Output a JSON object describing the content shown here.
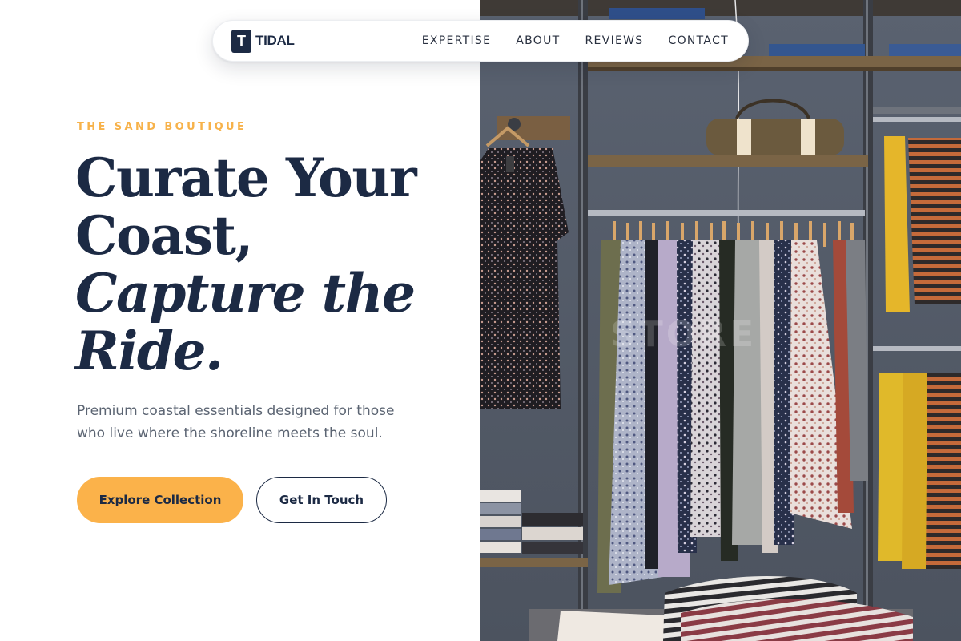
{
  "brand": {
    "logo_letter": "T",
    "name": "TIDAL"
  },
  "nav": {
    "links": [
      {
        "label": "EXPERTISE"
      },
      {
        "label": "ABOUT"
      },
      {
        "label": "REVIEWS"
      },
      {
        "label": "CONTACT"
      }
    ]
  },
  "hero": {
    "eyebrow": "THE SAND BOUTIQUE",
    "headline_line1": "Curate Your",
    "headline_line2": "Coast,",
    "headline_line3": "Capture the",
    "headline_line4": "Ride.",
    "description": "Premium coastal essentials designed for those who live where the shoreline meets the soul.",
    "primary_button": "Explore Collection",
    "secondary_button": "Get In Touch",
    "image_watermark": "STORE"
  },
  "colors": {
    "accent": "#FBB24A",
    "navy": "#1C2A44",
    "body_text": "#5B6472",
    "background": "#FFFFFF"
  }
}
